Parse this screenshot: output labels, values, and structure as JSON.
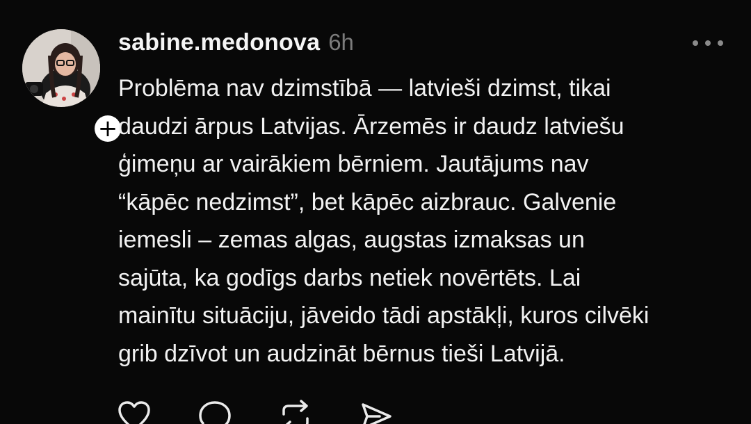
{
  "post": {
    "username": "sabine.medonova",
    "time": "6h",
    "text": "Problēma nav dzimstībā — latvieši dzimst, tikai\ndaudzi ārpus Latvijas. Ārzemēs ir daudz latviešu\nģimeņu ar vairākiem bērniem. Jautājums nav\n“kāpēc nedzimst”, bet kāpēc aizbrauc. Galvenie\niemesli – zemas algas, augstas izmaksas un\nsajūta, ka godīgs darbs netiek novērtēts. Lai\nmainītu situāciju, jāveido tādi apstākļi, kuros cilvēki\ngrib dzīvot un audzināt bērnus tieši Latvijā.",
    "follow_symbol": "+"
  },
  "icons": {
    "more": "more-horizontal-icon",
    "like": "heart-icon",
    "reply": "comment-icon",
    "repost": "repost-icon",
    "share": "send-icon"
  },
  "colors": {
    "background": "#080808",
    "text": "#f2f2f2",
    "muted": "#7c7c7c"
  }
}
